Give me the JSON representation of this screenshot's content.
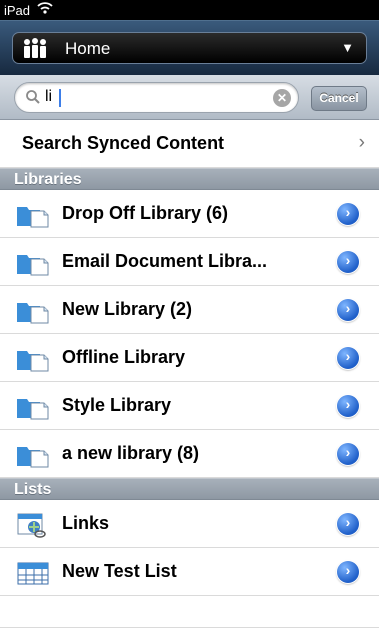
{
  "status_bar": {
    "carrier": "iPad",
    "wifi_icon": "wifi-icon"
  },
  "nav": {
    "site_title": "Home",
    "site_icon": "people-icon",
    "dropdown_icon": "triangle-down-icon"
  },
  "search": {
    "query": "li",
    "clear_icon": "clear-icon",
    "search_icon": "magnifier-icon",
    "cancel_label": "Cancel"
  },
  "list": {
    "search_synced": "Search Synced Content",
    "sections": {
      "libraries": "Libraries",
      "lists": "Lists"
    },
    "libraries": [
      {
        "label": "Drop Off Library (6)",
        "icon": "document-library-icon"
      },
      {
        "label": "Email Document Libra...",
        "icon": "document-library-icon"
      },
      {
        "label": "New Library (2)",
        "icon": "document-library-icon"
      },
      {
        "label": "Offline Library",
        "icon": "document-library-icon"
      },
      {
        "label": "Style Library",
        "icon": "document-library-icon"
      },
      {
        "label": "a new library (8)",
        "icon": "document-library-icon"
      }
    ],
    "lists": [
      {
        "label": "Links",
        "icon": "links-list-icon"
      },
      {
        "label": "New Test List",
        "icon": "custom-list-icon"
      }
    ],
    "disclosure_icon": "disclosure-button-icon"
  },
  "colors": {
    "accent": "#1f5fc9",
    "nav_bar": "#2a4663",
    "section_header": "#9aa3ad"
  }
}
